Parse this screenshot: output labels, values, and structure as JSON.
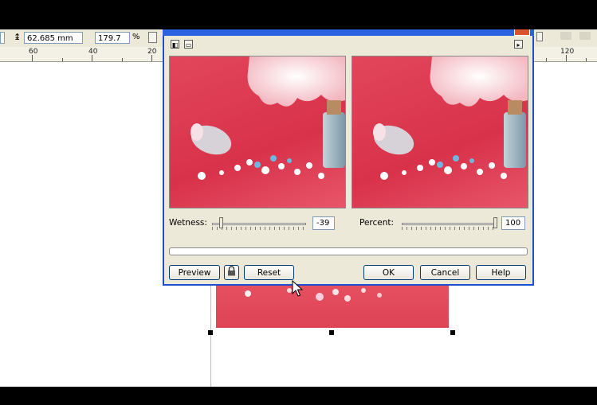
{
  "property_bar": {
    "height_value": "62.685 mm",
    "scale_value": "179.7",
    "scale_unit": "%"
  },
  "ruler": {
    "labels": [
      "60",
      "40",
      "20",
      "120"
    ]
  },
  "dialog": {
    "wetness": {
      "label": "Wetness:",
      "value": "-39",
      "level": -39
    },
    "percent": {
      "label": "Percent:",
      "value": "100",
      "level": 100
    },
    "buttons": {
      "preview": "Preview",
      "reset": "Reset",
      "ok": "OK",
      "cancel": "Cancel",
      "help": "Help"
    }
  },
  "colors": {
    "dialog_border": "#1c4fcf",
    "photo_red": "#e2465a",
    "dialog_bg": "#ece9d8"
  },
  "icons": [
    "lock-icon",
    "arrow-cursor-icon",
    "close-icon",
    "play-arrow-icon"
  ]
}
